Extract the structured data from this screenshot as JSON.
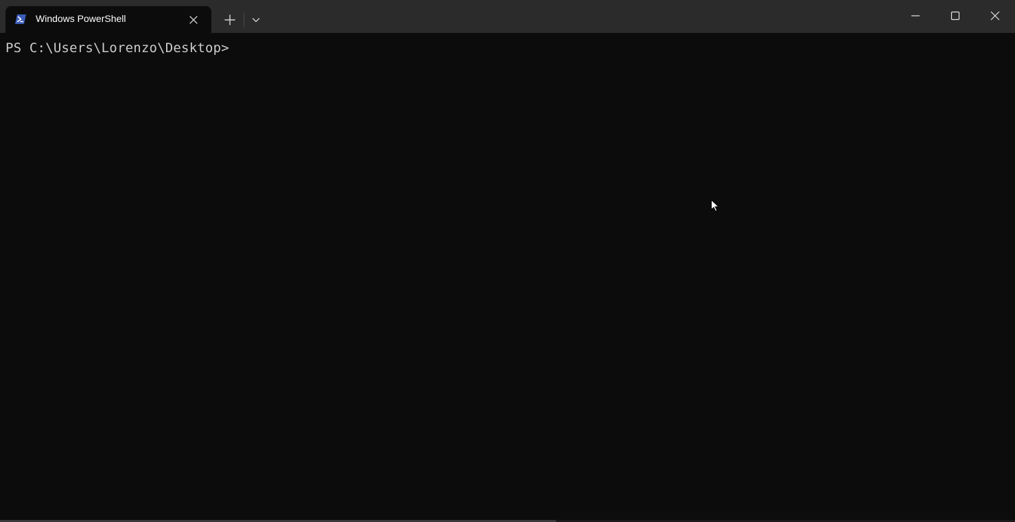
{
  "window": {
    "tab_title": "Windows PowerShell",
    "tab_icon": "powershell-icon",
    "buttons": {
      "new_tab_icon": "plus-icon",
      "dropdown_icon": "chevron-down-icon",
      "minimize_icon": "minimize-icon",
      "maximize_icon": "maximize-icon",
      "close_icon": "close-icon"
    }
  },
  "terminal": {
    "prompt": "PS C:\\Users\\Lorenzo\\Desktop>"
  },
  "colors": {
    "titlebar": "#2b2b2b",
    "background": "#0c0c0c",
    "text": "#cccccc",
    "accent": "#3b5cb8"
  }
}
